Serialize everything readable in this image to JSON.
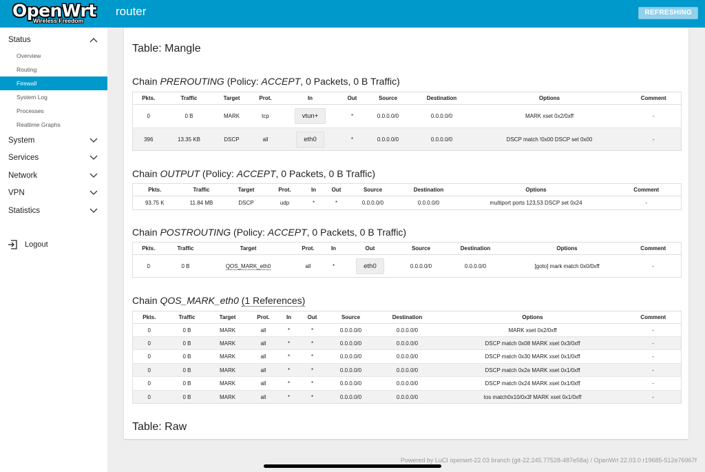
{
  "header": {
    "brand_name": "OpenWrt",
    "brand_tagline": "Wireless Freedom",
    "hostname": "router",
    "refresh_label": "REFRESHING"
  },
  "sidebar": {
    "groups": [
      {
        "label": "Status",
        "expanded": true
      },
      {
        "label": "System"
      },
      {
        "label": "Services"
      },
      {
        "label": "Network"
      },
      {
        "label": "VPN"
      },
      {
        "label": "Statistics"
      }
    ],
    "status_items": [
      "Overview",
      "Routing",
      "Firewall",
      "System Log",
      "Processes",
      "Realtime Graphs"
    ],
    "active_item": "Firewall",
    "logout_label": "Logout"
  },
  "main": {
    "table_mangle": "Table: Mangle",
    "table_raw": "Table: Raw",
    "chains": [
      {
        "prefix": "Chain ",
        "name": "PREROUTING",
        "policy_open": " (Policy: ",
        "policy": "ACCEPT",
        "policy_rest": ", 0 Packets, 0 B Traffic)",
        "columns": [
          "Pkts.",
          "Traffic",
          "Target",
          "Prot.",
          "In",
          "Out",
          "Source",
          "Destination",
          "Options",
          "Comment"
        ],
        "rows": [
          [
            "0",
            "0 B",
            "MARK",
            "tcp",
            "vtun+",
            "*",
            "0.0.0.0/0",
            "0.0.0.0/0",
            "MARK xset 0x2/0xff",
            "-"
          ],
          [
            "396",
            "13.35 KB",
            "DSCP",
            "all",
            "eth0",
            "*",
            "0.0.0.0/0",
            "0.0.0.0/0",
            "DSCP match !0x00 DSCP set 0x00",
            "-"
          ]
        ]
      },
      {
        "prefix": "Chain ",
        "name": "OUTPUT",
        "policy_open": " (Policy: ",
        "policy": "ACCEPT",
        "policy_rest": ", 0 Packets, 0 B Traffic)",
        "columns": [
          "Pkts.",
          "Traffic",
          "Target",
          "Prot.",
          "In",
          "Out",
          "Source",
          "Destination",
          "Options",
          "Comment"
        ],
        "rows": [
          [
            "93.75 K",
            "11.84 MB",
            "DSCP",
            "udp",
            "*",
            "*",
            "0.0.0.0/0",
            "0.0.0.0/0",
            "multiport ports 123,53 DSCP set 0x24",
            "-"
          ]
        ]
      },
      {
        "prefix": "Chain ",
        "name": "POSTROUTING",
        "policy_open": " (Policy: ",
        "policy": "ACCEPT",
        "policy_rest": ", 0 Packets, 0 B Traffic)",
        "columns": [
          "Pkts.",
          "Traffic",
          "Target",
          "Prot.",
          "In",
          "Out",
          "Source",
          "Destination",
          "Options",
          "Comment"
        ],
        "rows": [
          [
            "0",
            "0 B",
            "QOS_MARK_eth0",
            "all",
            "*",
            "eth0",
            "0.0.0.0/0",
            "0.0.0.0/0",
            "[goto] mark match 0x0/0xff",
            "-"
          ]
        ]
      },
      {
        "prefix": "Chain ",
        "name": "QOS_MARK_eth0",
        "references": "(1 References)",
        "columns": [
          "Pkts.",
          "Traffic",
          "Target",
          "Prot.",
          "In",
          "Out",
          "Source",
          "Destination",
          "Options",
          "Comment"
        ],
        "rows": [
          [
            "0",
            "0 B",
            "MARK",
            "all",
            "*",
            "*",
            "0.0.0.0/0",
            "0.0.0.0/0",
            "MARK xset 0x2/0xff",
            "-"
          ],
          [
            "0",
            "0 B",
            "MARK",
            "all",
            "*",
            "*",
            "0.0.0.0/0",
            "0.0.0.0/0",
            "DSCP match 0x08 MARK xset 0x3/0xff",
            "-"
          ],
          [
            "0",
            "0 B",
            "MARK",
            "all",
            "*",
            "*",
            "0.0.0.0/0",
            "0.0.0.0/0",
            "DSCP match 0x30 MARK xset 0x1/0xff",
            "-"
          ],
          [
            "0",
            "0 B",
            "MARK",
            "all",
            "*",
            "*",
            "0.0.0.0/0",
            "0.0.0.0/0",
            "DSCP match 0x2e MARK xset 0x1/0xff",
            "-"
          ],
          [
            "0",
            "0 B",
            "MARK",
            "all",
            "*",
            "*",
            "0.0.0.0/0",
            "0.0.0.0/0",
            "DSCP match 0x24 MARK xset 0x1/0xff",
            "-"
          ],
          [
            "0",
            "0 B",
            "MARK",
            "all",
            "*",
            "*",
            "0.0.0.0/0",
            "0.0.0.0/0",
            "tos match0x10/0x3f MARK xset 0x1/0xff",
            "-"
          ]
        ]
      }
    ]
  },
  "footer": {
    "text": "Powered by LuCI openwrt-22.03 branch (git-22.245.77528-487e58a) / OpenWrt 22.03.0 r19685-512e76967f"
  },
  "colors": {
    "header_bg": "#0099cc",
    "active_item_bg": "#0099cc",
    "page_bg": "#eeeeee"
  },
  "icons": {
    "group_chevron": "chevron-icon",
    "logout": "logout-icon"
  }
}
